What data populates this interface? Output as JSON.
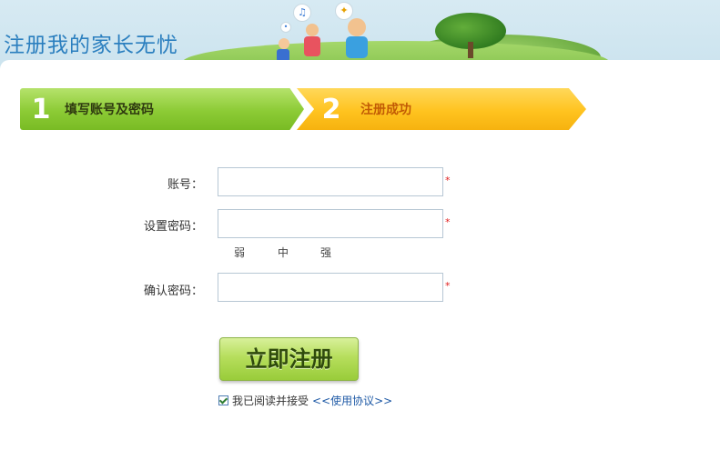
{
  "header": {
    "title": "注册我的家长无忧"
  },
  "steps": [
    {
      "number": "1",
      "label": "填写账号及密码",
      "color": "#8ccb35"
    },
    {
      "number": "2",
      "label": "注册成功",
      "color": "#ffc31f"
    }
  ],
  "form": {
    "account_label": "账号：",
    "account_value": "",
    "password_label": "设置密码：",
    "password_value": "",
    "strength": [
      "弱",
      "中",
      "强"
    ],
    "confirm_label": "确认密码：",
    "confirm_value": "",
    "required_mark": "*"
  },
  "submit_label": "立即注册",
  "agreement": {
    "checked": true,
    "text": "我已阅读并接受",
    "link": "<<使用协议>>"
  }
}
